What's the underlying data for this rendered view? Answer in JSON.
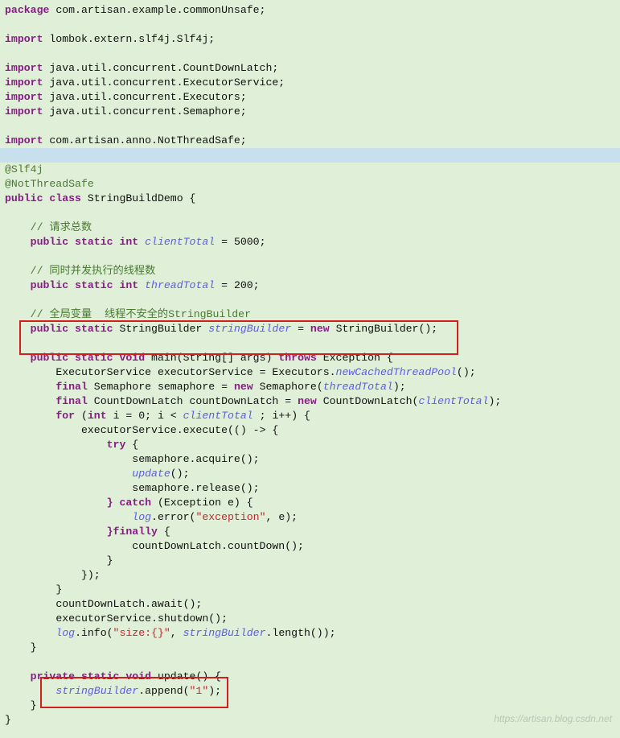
{
  "pkg_kw": "package",
  "pkg_name": " com.artisan.example.commonUnsafe;",
  "imp_kw": "import",
  "imp_lombok": " lombok.extern.slf4j.Slf4j;",
  "imp_cdl": " java.util.concurrent.CountDownLatch;",
  "imp_es": " java.util.concurrent.ExecutorService;",
  "imp_ex": " java.util.concurrent.Executors;",
  "imp_sem": " java.util.concurrent.Semaphore;",
  "imp_anno": " com.artisan.anno.NotThreadSafe;",
  "anno_slf4j": "@Slf4j",
  "anno_nts": "@NotThreadSafe",
  "pub_kw": "public",
  "class_kw": "class",
  "class_name": " StringBuildDemo {",
  "cmt_reqtotal": "// 请求总数",
  "static_kw": "static",
  "int_kw": "int",
  "field_clientTotal": "clientTotal",
  "val_5000": " = 5000;",
  "cmt_threadtotal": "// 同时并发执行的线程数",
  "field_threadTotal": "threadTotal",
  "val_200": " = 200;",
  "cmt_sb": "// 全局变量  线程不安全的StringBuilder",
  "type_sb": "StringBuilder ",
  "field_sb": "stringBuilder",
  "eq_new": " = ",
  "new_kw": "new",
  "sb_ctor": " StringBuilder();",
  "void_kw": "void",
  "main_sig_a": " main(String[] ",
  "args_var": "args",
  "main_sig_b": ") ",
  "throws_kw": "throws",
  "exception_cls": " Exception {",
  "line_es_a": "ExecutorService ",
  "line_es_var": "executorService",
  "line_es_b": " = Executors.",
  "line_es_call": "newCachedThreadPool",
  "line_es_c": "();",
  "final_kw": "final",
  "sem_decl_a": " Semaphore ",
  "sem_var": "semaphore",
  "sem_decl_b": " Semaphore(",
  "sem_decl_c": ");",
  "cdl_decl_a": " CountDownLatch ",
  "cdl_var": "countDownLatch",
  "cdl_decl_b": " CountDownLatch(",
  "cdl_decl_c": ");",
  "for_kw": "for",
  "for_a": " (",
  "for_i": "i",
  "for_b": " = 0; ",
  "for_c": " < ",
  "for_d": " ; ",
  "for_e": "++) {",
  "exec_a": ".execute(() -> {",
  "try_kw": "try",
  "try_open": " {",
  "sem_acq": ".acquire();",
  "update_call": "update",
  "update_suffix": "();",
  "sem_rel": ".release();",
  "catch_kw": "} catch",
  "catch_sig": " (Exception ",
  "catch_e": "e",
  "catch_close": ") {",
  "logvar": "log",
  "log_error_a": ".error(",
  "str_exception": "\"exception\"",
  "log_error_b": ", ",
  "log_error_c": ");",
  "finally_kw": "}finally",
  "finally_open": " {",
  "cdl_countdown": ".countDown();",
  "brace_close": "}",
  "lambda_close": "});",
  "cdl_await": ".await();",
  "es_shutdown": ".shutdown();",
  "log_info_a": ".info(",
  "str_size": "\"size:{}\"",
  "log_info_b": ", ",
  "sb_len": ".length());",
  "priv_kw": "private",
  "update_sig": " update() {",
  "sb_append_a": ".append(",
  "str_one": "\"1\"",
  "sb_append_b": ");",
  "watermark": "https://artisan.blog.csdn.net"
}
